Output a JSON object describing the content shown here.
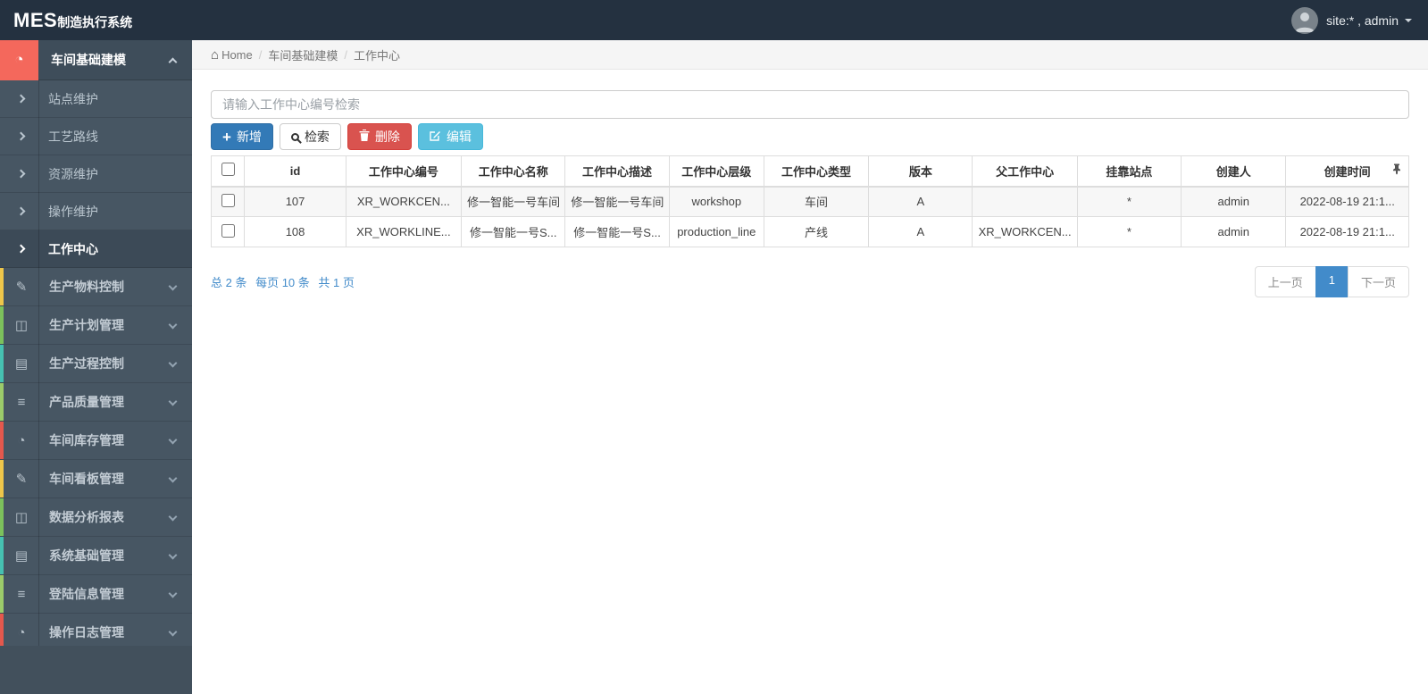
{
  "app": {
    "brand_mes": "MES",
    "brand_rest": "制造执行系统",
    "user": "site:* , admin"
  },
  "colors": {
    "header_bg": "#243140",
    "sidebar_bg": "#475663",
    "sidebar_active_red": "#f4685c",
    "accent_blue": "#428bca",
    "primary_btn": "#337ab7",
    "danger_btn": "#d9534f",
    "info_btn": "#5bc0de"
  },
  "breadcrumb": {
    "home": "Home",
    "level1": "车间基础建模",
    "level2": "工作中心"
  },
  "sidebar": {
    "root": {
      "label": "车间基础建模",
      "icon": "gauge"
    },
    "submenu": [
      {
        "label": "站点维护",
        "active": false
      },
      {
        "label": "工艺路线",
        "active": false
      },
      {
        "label": "资源维护",
        "active": false
      },
      {
        "label": "操作维护",
        "active": false
      },
      {
        "label": "工作中心",
        "active": true
      }
    ],
    "items": [
      {
        "label": "生产物料控制",
        "icon": "pencil",
        "stripe": "#eec64a"
      },
      {
        "label": "生产计划管理",
        "icon": "columns",
        "stripe": "#7cc15c"
      },
      {
        "label": "生产过程控制",
        "icon": "book",
        "stripe": "#46c1b1"
      },
      {
        "label": "产品质量管理",
        "icon": "list",
        "stripe": "#9bcb6a"
      },
      {
        "label": "车间库存管理",
        "icon": "gauge",
        "stripe": "#e4584d"
      },
      {
        "label": "车间看板管理",
        "icon": "pencil",
        "stripe": "#eec64a"
      },
      {
        "label": "数据分析报表",
        "icon": "columns",
        "stripe": "#7cc15c"
      },
      {
        "label": "系统基础管理",
        "icon": "book",
        "stripe": "#46c1b1"
      },
      {
        "label": "登陆信息管理",
        "icon": "list",
        "stripe": "#9bcb6a"
      },
      {
        "label": "操作日志管理",
        "icon": "gauge",
        "stripe": "#e4584d"
      }
    ]
  },
  "toolbar": {
    "search_placeholder": "请输入工作中心编号检索",
    "add_label": "新增",
    "search_label": "检索",
    "delete_label": "删除",
    "edit_label": "编辑"
  },
  "table": {
    "headers": [
      "id",
      "工作中心编号",
      "工作中心名称",
      "工作中心描述",
      "工作中心层级",
      "工作中心类型",
      "版本",
      "父工作中心",
      "挂靠站点",
      "创建人",
      "创建时间"
    ],
    "rows": [
      [
        "107",
        "XR_WORKCEN...",
        "修一智能一号车间",
        "修一智能一号车间",
        "workshop",
        "车间",
        "A",
        "",
        "*",
        "admin",
        "2022-08-19 21:1..."
      ],
      [
        "108",
        "XR_WORKLINE...",
        "修一智能一号S...",
        "修一智能一号S...",
        "production_line",
        "产线",
        "A",
        "XR_WORKCEN...",
        "*",
        "admin",
        "2022-08-19 21:1..."
      ]
    ]
  },
  "pagination": {
    "summary_total": "总 2 条",
    "summary_per_page": "每页 10 条",
    "summary_pages": "共 1 页",
    "prev": "上一页",
    "page": "1",
    "next": "下一页"
  }
}
